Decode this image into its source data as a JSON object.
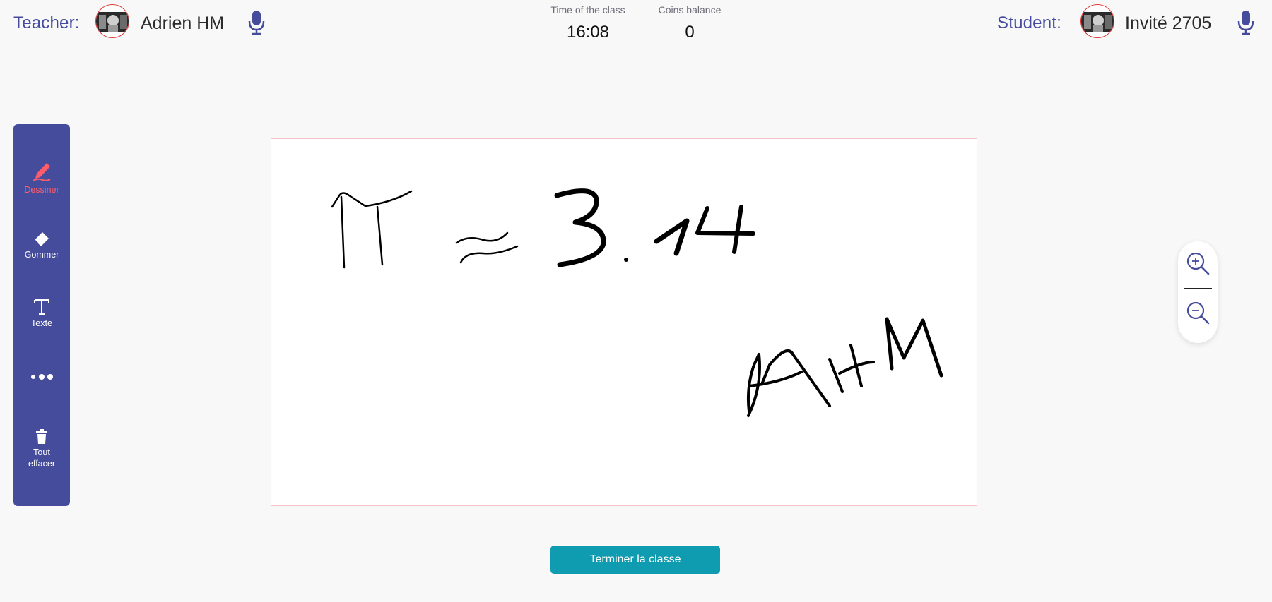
{
  "header": {
    "teacher": {
      "role_label": "Teacher:",
      "name": "Adrien HM",
      "avatar_icon": "user-avatar",
      "mic_icon": "microphone-icon"
    },
    "student": {
      "role_label": "Student:",
      "name": "Invité 2705",
      "avatar_icon": "user-avatar",
      "mic_icon": "microphone-icon"
    },
    "time": {
      "label": "Time of the class",
      "value": "16:08"
    },
    "coins": {
      "label": "Coins balance",
      "value": "0"
    }
  },
  "toolbar": {
    "items": [
      {
        "id": "draw",
        "label": "Dessiner",
        "icon": "pen-icon",
        "active": true
      },
      {
        "id": "erase",
        "label": "Gommer",
        "icon": "eraser-icon",
        "active": false
      },
      {
        "id": "text",
        "label": "Texte",
        "icon": "text-icon",
        "active": false
      },
      {
        "id": "more",
        "label": "",
        "icon": "more-icon",
        "active": false
      },
      {
        "id": "clear",
        "label": "Tout effacer",
        "icon": "trash-icon",
        "active": false
      }
    ]
  },
  "whiteboard": {
    "handwriting": "π ≈ 3.14  AHM"
  },
  "zoom": {
    "zoom_in_icon": "zoom-in-icon",
    "zoom_out_icon": "zoom-out-icon"
  },
  "actions": {
    "end_class_label": "Terminer la classe"
  },
  "colors": {
    "accent": "#464c9c",
    "active_tool": "#ff5d6c",
    "end_button": "#0f9bb0",
    "background": "#f8f8f8"
  }
}
